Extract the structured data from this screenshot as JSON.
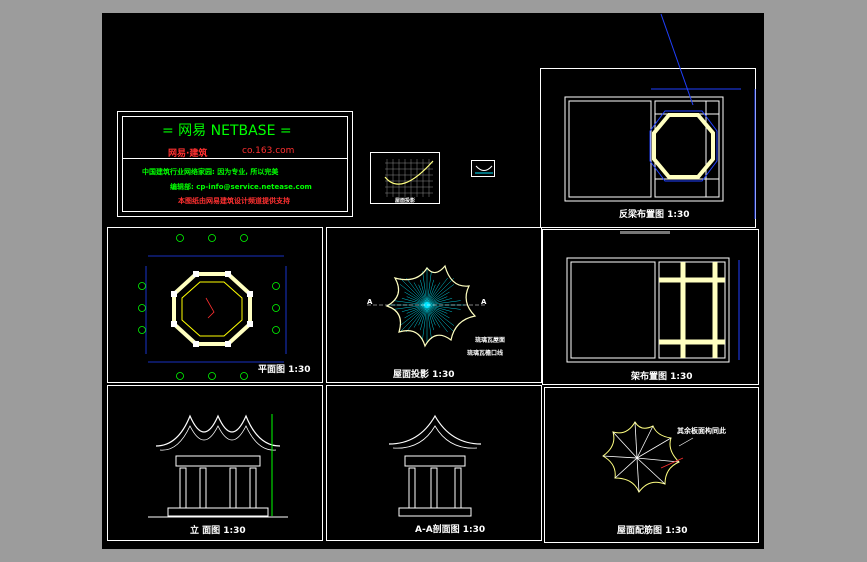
{
  "colors": {
    "background": "#9c9c9c",
    "canvas": "#000000",
    "frame": "#ffffff",
    "accent_green": "#00ff00",
    "accent_red": "#ff3030",
    "accent_yellow": "#ffff00",
    "dim_blue": "#2040ff",
    "cyan": "#00e5ff",
    "cream": "#ffffc0"
  },
  "titleblock": {
    "brand": "= 网易 NETBASE =",
    "sub_left": "网易·建筑",
    "sub_right": "co.163.com",
    "line1": "中国建筑行业网络家园: 因为专业, 所以完美",
    "line2": "编辑部: cp-info@service.netease.com",
    "line3": "本图纸由网易建筑设计频道提供支持"
  },
  "thumb_label": "屋面投影",
  "views": {
    "roof_frame_plan": "反梁布置图 1:30",
    "floor_plan": "平面图 1:30",
    "roof_projection": "屋面投影 1:30",
    "frame_layout": "架布置图 1:30",
    "elevation": "立 面图 1:30",
    "section_aa": "A-A剖面图 1:30",
    "roof_rebar": "屋面配筋图 1:30"
  },
  "annotations": {
    "proj_note1": "琉璃瓦屋面",
    "proj_note2": "琉璃瓦檐口线",
    "rebar_note": "其余板面构同此",
    "section_a": "A"
  }
}
